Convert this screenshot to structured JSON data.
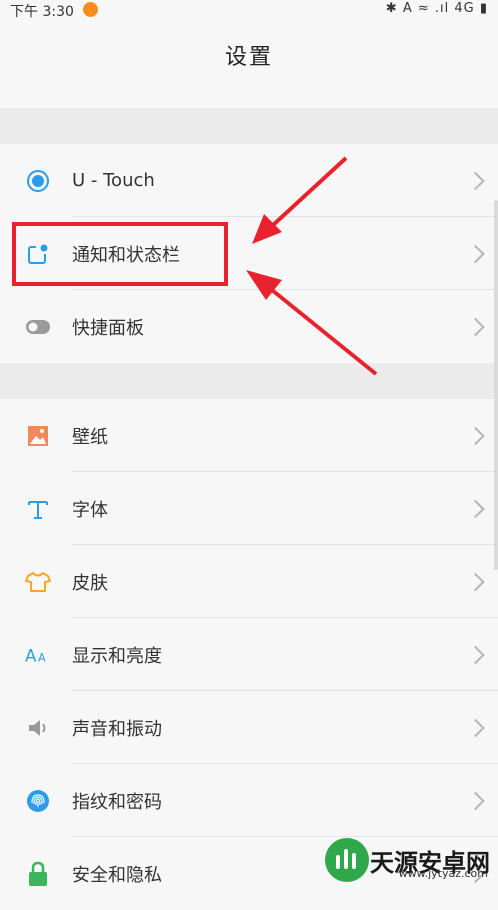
{
  "status_bar": {
    "time": "下午 3:30",
    "right_text": "✱ A ≈ .ıl 4G ▮"
  },
  "header": {
    "title": "设置"
  },
  "group1": [
    {
      "label": "U - Touch",
      "icon": "utouch-icon"
    },
    {
      "label": "通知和状态栏",
      "icon": "notification-icon"
    },
    {
      "label": "快捷面板",
      "icon": "toggle-icon"
    }
  ],
  "group2": [
    {
      "label": "壁纸",
      "icon": "wallpaper-icon"
    },
    {
      "label": "字体",
      "icon": "font-icon"
    },
    {
      "label": "皮肤",
      "icon": "theme-icon"
    },
    {
      "label": "显示和亮度",
      "icon": "display-icon"
    },
    {
      "label": "声音和振动",
      "icon": "sound-icon"
    },
    {
      "label": "指纹和密码",
      "icon": "fingerprint-icon"
    },
    {
      "label": "安全和隐私",
      "icon": "lock-icon"
    }
  ],
  "watermark": {
    "text": "天源安卓网",
    "url": "www.jytyaz.com"
  },
  "colors": {
    "accent_blue": "#2d9bea",
    "annotation_red": "#e8232e"
  }
}
